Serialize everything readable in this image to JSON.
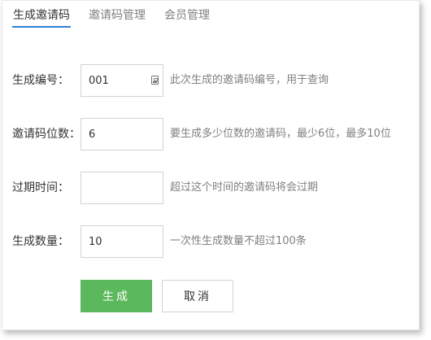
{
  "tabs": [
    {
      "label": "生成邀请码",
      "active": true
    },
    {
      "label": "邀请码管理",
      "active": false
    },
    {
      "label": "会员管理",
      "active": false
    }
  ],
  "form": {
    "serial": {
      "label": "生成编号：",
      "value": "001",
      "hint": "此次生成的邀请码编号，用于查询",
      "icon": "contact-card-icon"
    },
    "digits": {
      "label": "邀请码位数：",
      "value": "6",
      "hint": "要生成多少位数的邀请码，最少6位，最多10位"
    },
    "expire": {
      "label": "过期时间：",
      "value": "",
      "hint": "超过这个时间的邀请码将会过期"
    },
    "count": {
      "label": "生成数量：",
      "value": "10",
      "hint": "一次性生成数量不超过100条"
    }
  },
  "buttons": {
    "generate": "生成",
    "cancel": "取消"
  },
  "colors": {
    "primary_button": "#5cb85c",
    "active_tab_underline": "#2f7fd6",
    "hint_text": "#808080",
    "border": "#d2d2d2"
  }
}
